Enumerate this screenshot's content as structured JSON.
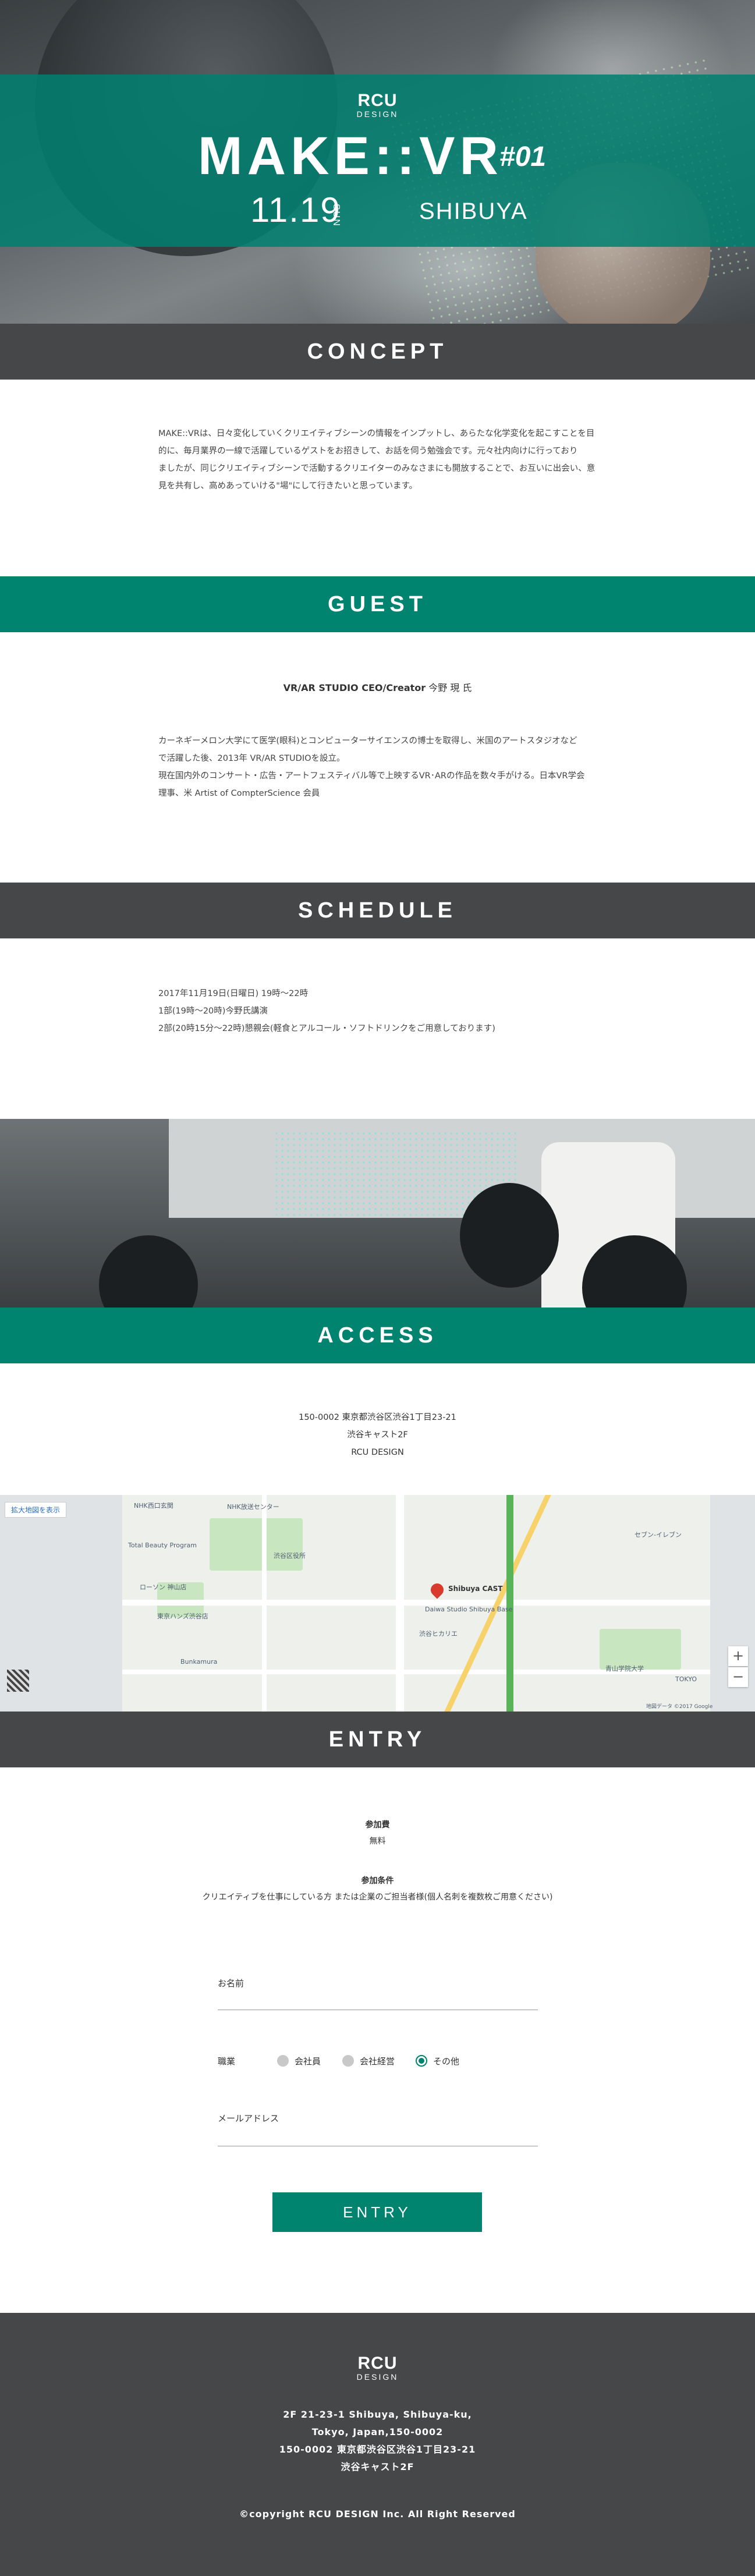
{
  "hero": {
    "logo_main": "RCU",
    "logo_sub": "DESIGN",
    "title": "MAKE::VR",
    "number": "#01",
    "date": "11.19",
    "day": "SUN",
    "place": "SHIBUYA"
  },
  "concept": {
    "heading": "CONCEPT",
    "lines": [
      "MAKE::VRは、日々変化していくクリエイティブシーンの情報をインプットし、あらたな化学変化を起こすことを目",
      "的に、毎月業界の一線で活躍しているゲストをお招きして、お話を伺う勉強会です。元々社内向けに行っており",
      "ましたが、同じクリエイティブシーンで活動するクリエイターのみなさまにも開放することで、お互いに出会い、意",
      "見を共有し、高めあっていける\"場\"にして行きたいと思っています。"
    ]
  },
  "guest": {
    "heading": "GUEST",
    "name_role": "VR/AR STUDIO CEO/Creator",
    "name": "今野 現 氏",
    "bio": [
      "カーネギーメロン大学にて医学(眼科)とコンピューターサイエンスの博士を取得し、米国のアートスタジオなど",
      "で活躍した後、2013年 VR/AR STUDIOを設立。",
      "現在国内外のコンサート・広告・アートフェスティバル等で上映するVR･ARの作品を数々手がける。日本VR学会",
      "理事、米 Artist of CompterScience 会員"
    ]
  },
  "schedule": {
    "heading": "SCHEDULE",
    "lines": [
      "2017年11月19日(日曜日) 19時〜22時",
      "1部(19時〜20時)今野氏講演",
      "2部(20時15分〜22時)懇親会(軽食とアルコール・ソフトドリンクをご用意しております)"
    ]
  },
  "access": {
    "heading": "ACCESS",
    "lines": [
      "150-0002 東京都渋谷区渋谷1丁目23-21",
      "渋谷キャスト2F",
      "RCU DESIGN"
    ]
  },
  "map": {
    "enlarge_label": "拡大地図を表示",
    "pin_label": "Shibuya CAST",
    "zoom_in": "+",
    "zoom_out": "−",
    "labels": [
      "NHK西口玄関",
      "NHK放送センター",
      "Total Beauty Program",
      "ローソン 神山店",
      "東京ハンズ渋谷店",
      "Bunkamura",
      "渋谷ヒカリエ",
      "青山学院大学",
      "渋谷区役所",
      "Daiwa Studio Shibuya Base",
      "セブン-イレブン",
      "TOKYO"
    ],
    "attribution": "地図データ ©2017 Google"
  },
  "entry": {
    "heading": "ENTRY",
    "fee_label": "参加費",
    "fee_value": "無料",
    "cond_label": "参加条件",
    "cond_value": "クリエイティブを仕事にしている方 または企業のご担当者様(個人名刺を複数枚ご用意ください)",
    "name_label": "お名前",
    "job_label": "職業",
    "job_options": [
      "会社員",
      "会社経営",
      "その他"
    ],
    "job_selected": "その他",
    "email_label": "メールアドレス",
    "submit": "ENTRY"
  },
  "footer": {
    "logo_main": "RCU",
    "logo_sub": "DESIGN",
    "address": [
      "2F 21-23-1 Shibuya, Shibuya-ku,",
      "Tokyo, Japan,150-0002",
      "150-0002 東京都渋谷区渋谷1丁目23-21",
      "渋谷キャスト2F"
    ],
    "copyright": "©copyright RCU DESIGN Inc. All Right Reserved"
  },
  "colors": {
    "teal": "#00836f",
    "dark": "#454749",
    "footer": "#464749"
  }
}
